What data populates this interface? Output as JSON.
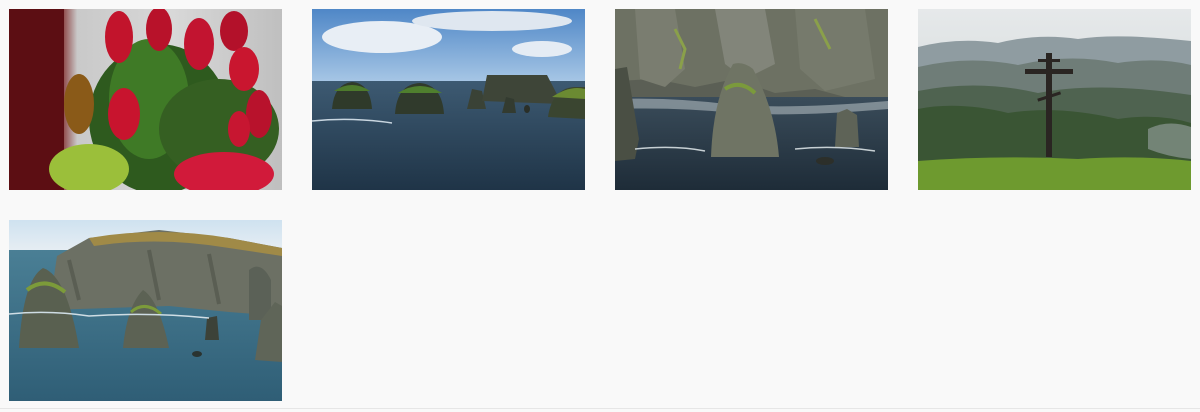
{
  "gallery": {
    "photos": [
      {
        "subject": "red-flowering-conifer-branch"
      },
      {
        "subject": "sea-stacks-open-water"
      },
      {
        "subject": "cliffs-and-sea-stack"
      },
      {
        "subject": "orthodox-cross-on-hill"
      },
      {
        "subject": "headland-with-sea-stacks"
      }
    ]
  }
}
